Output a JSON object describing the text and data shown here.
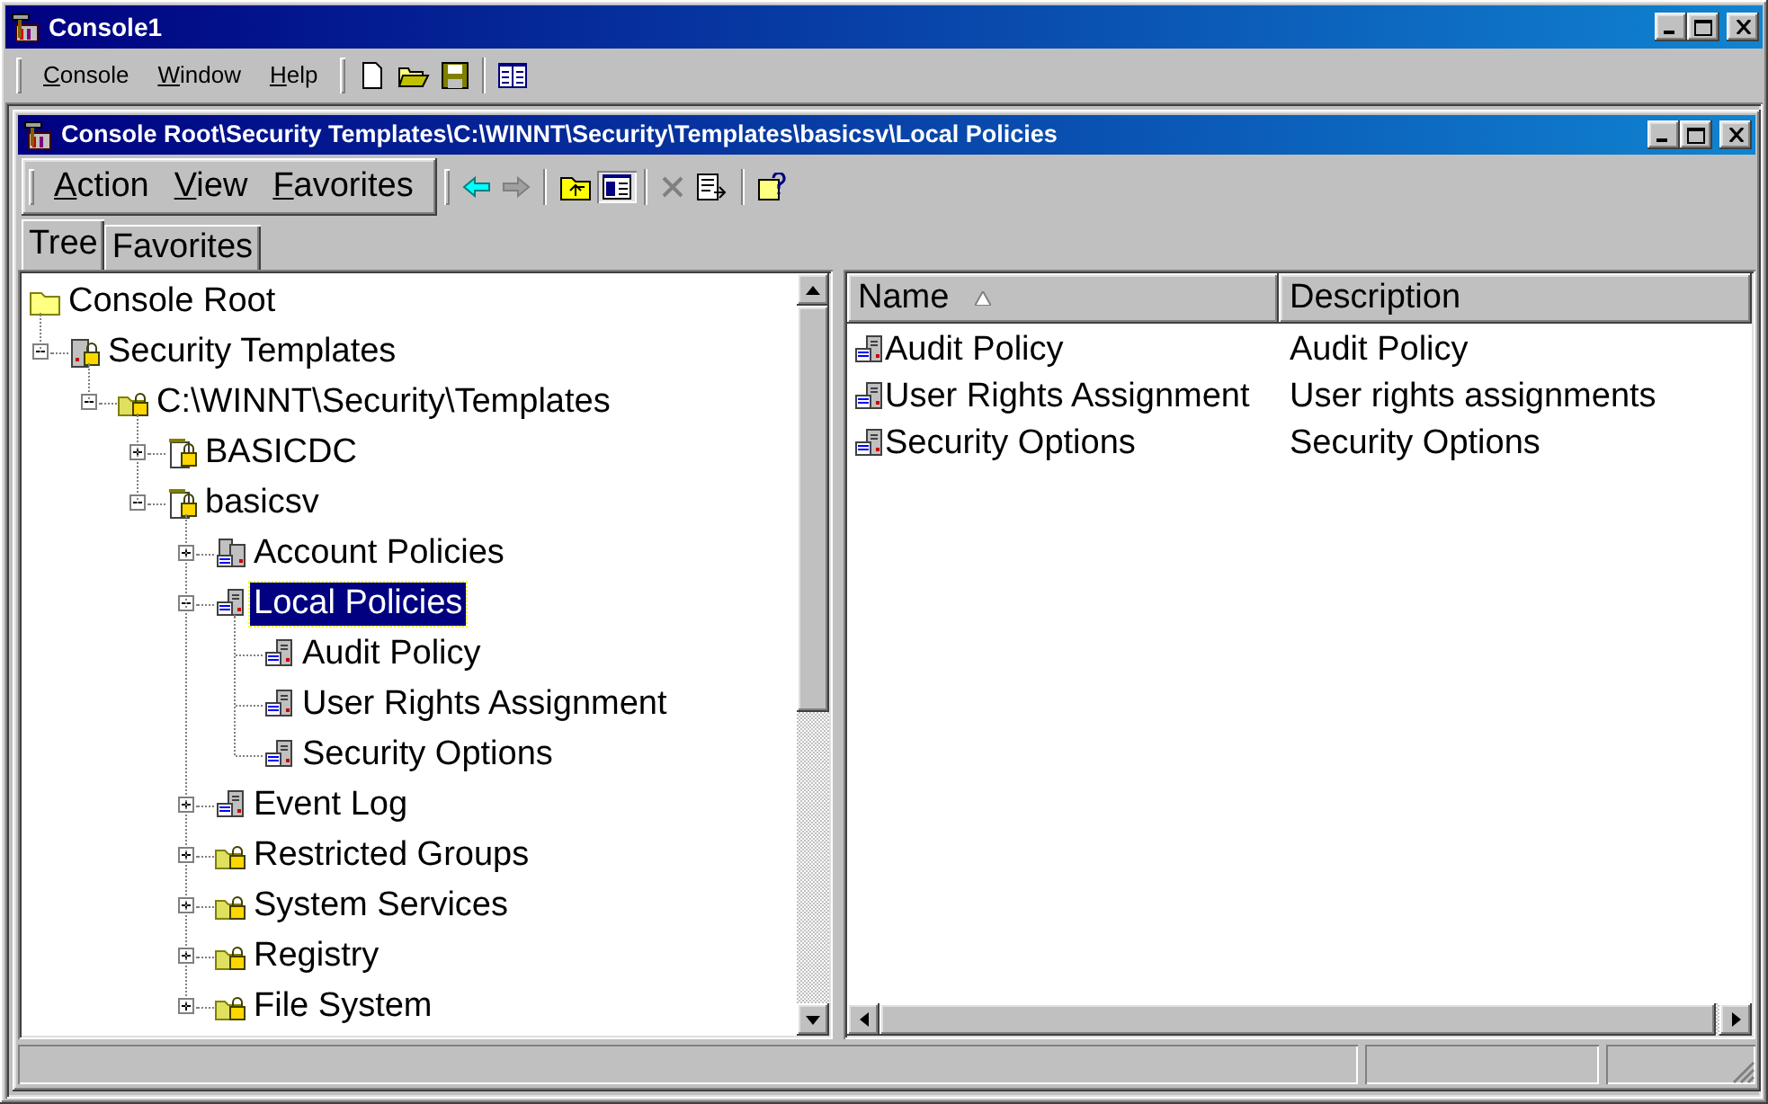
{
  "window": {
    "title": "Console1",
    "menu": [
      "Console",
      "Window",
      "Help"
    ]
  },
  "child_window": {
    "title": "Console Root\\Security Templates\\C:\\WINNT\\Security\\Templates\\basicsv\\Local Policies",
    "menu": [
      "Action",
      "View",
      "Favorites"
    ]
  },
  "tabs": [
    {
      "label": "Tree",
      "selected": true
    },
    {
      "label": "Favorites",
      "selected": false
    }
  ],
  "tree": [
    {
      "label": "Console Root",
      "kind": "folder",
      "selected": false,
      "children": [
        {
          "label": "Security Templates",
          "kind": "store",
          "expanded": true,
          "selected": false,
          "children": [
            {
              "label": "C:\\WINNT\\Security\\Templates",
              "kind": "locked-folder",
              "expanded": true,
              "selected": false,
              "children": [
                {
                  "label": "BASICDC",
                  "kind": "template",
                  "expanded": false,
                  "selected": false
                },
                {
                  "label": "basicsv",
                  "kind": "template",
                  "expanded": true,
                  "selected": false,
                  "children": [
                    {
                      "label": "Account Policies",
                      "kind": "policy-group",
                      "expanded": false,
                      "selected": false
                    },
                    {
                      "label": "Local Policies",
                      "kind": "policy",
                      "expanded": true,
                      "selected": true,
                      "children": [
                        {
                          "label": "Audit Policy",
                          "kind": "policy",
                          "selected": false
                        },
                        {
                          "label": "User Rights Assignment",
                          "kind": "policy",
                          "selected": false
                        },
                        {
                          "label": "Security Options",
                          "kind": "policy",
                          "selected": false
                        }
                      ]
                    },
                    {
                      "label": "Event Log",
                      "kind": "policy",
                      "expanded": false,
                      "selected": false
                    },
                    {
                      "label": "Restricted Groups",
                      "kind": "locked-folder",
                      "expanded": false,
                      "selected": false
                    },
                    {
                      "label": "System Services",
                      "kind": "locked-folder",
                      "expanded": false,
                      "selected": false
                    },
                    {
                      "label": "Registry",
                      "kind": "locked-folder",
                      "expanded": false,
                      "selected": false
                    },
                    {
                      "label": "File System",
                      "kind": "locked-folder",
                      "expanded": false,
                      "selected": false
                    }
                  ]
                }
              ]
            }
          ]
        }
      ]
    }
  ],
  "list": {
    "columns": [
      {
        "label": "Name",
        "sorted": true
      },
      {
        "label": "Description",
        "sorted": false
      }
    ],
    "rows": [
      {
        "name": "Audit Policy",
        "description": "Audit Policy"
      },
      {
        "name": "User Rights Assignment",
        "description": "User rights assignments"
      },
      {
        "name": "Security Options",
        "description": "Security Options"
      }
    ]
  }
}
